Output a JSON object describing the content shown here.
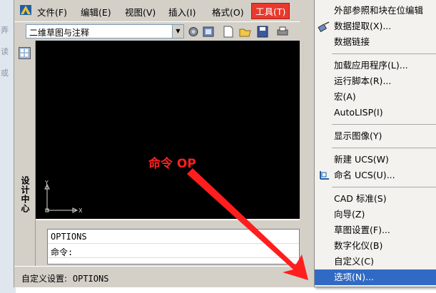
{
  "background_window": {
    "fragments": [
      "弄",
      "读",
      "或"
    ]
  },
  "menubar": {
    "items": [
      {
        "label": "文件(F)"
      },
      {
        "label": "编辑(E)"
      },
      {
        "label": "视图(V)"
      },
      {
        "label": "插入(I)"
      },
      {
        "label": "格式(O)"
      },
      {
        "label": "工具(T)"
      }
    ]
  },
  "toolbar": {
    "workspace": "二维草图与注释"
  },
  "palette": {
    "title": "设计中心"
  },
  "command": {
    "history": "OPTIONS",
    "prompt": "命令:"
  },
  "status": {
    "label": "自定义设置:",
    "value": "OPTIONS"
  },
  "tools_menu": {
    "items": [
      {
        "label": "外部参照和块在位编辑",
        "icon": ""
      },
      {
        "label": "数据提取(X)...",
        "icon": "data-extract-icon"
      },
      {
        "label": "数据链接",
        "icon": ""
      },
      {
        "label": "加载应用程序(L)...",
        "icon": ""
      },
      {
        "label": "运行脚本(R)...",
        "icon": ""
      },
      {
        "label": "宏(A)",
        "icon": ""
      },
      {
        "label": "AutoLISP(I)",
        "icon": ""
      },
      {
        "label": "显示图像(Y)",
        "icon": ""
      },
      {
        "label": "新建 UCS(W)",
        "icon": ""
      },
      {
        "label": "命名 UCS(U)...",
        "icon": "named-ucs-icon"
      },
      {
        "label": "CAD 标准(S)",
        "icon": ""
      },
      {
        "label": "向导(Z)",
        "icon": ""
      },
      {
        "label": "草图设置(F)...",
        "icon": ""
      },
      {
        "label": "数字化仪(B)",
        "icon": ""
      },
      {
        "label": "自定义(C)",
        "icon": ""
      },
      {
        "label": "选项(N)...",
        "icon": ""
      }
    ]
  },
  "annotation": {
    "text": "命令 OP"
  },
  "colors": {
    "menu_highlight": "#e8392d",
    "item_highlight": "#316ac5",
    "annotation": "#ff2020",
    "canvas": "#000000"
  }
}
